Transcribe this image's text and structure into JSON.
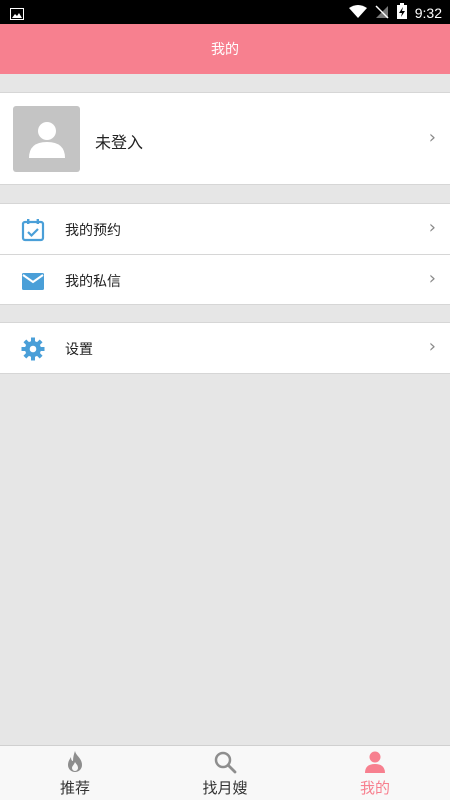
{
  "status_bar": {
    "time": "9:32"
  },
  "header": {
    "title": "我的"
  },
  "profile": {
    "login_label": "未登入"
  },
  "menu": {
    "items": [
      {
        "label": "我的预约",
        "icon": "calendar-check-icon"
      },
      {
        "label": "我的私信",
        "icon": "mail-icon"
      }
    ]
  },
  "settings": {
    "label": "设置",
    "icon": "gear-icon"
  },
  "tabs": [
    {
      "label": "推荐",
      "icon": "flame-icon",
      "active": false
    },
    {
      "label": "找月嫂",
      "icon": "search-icon",
      "active": false
    },
    {
      "label": "我的",
      "icon": "person-icon",
      "active": true
    }
  ],
  "colors": {
    "accent": "#f7808f",
    "icon_blue": "#4a9fd8",
    "background": "#e6e6e6"
  }
}
